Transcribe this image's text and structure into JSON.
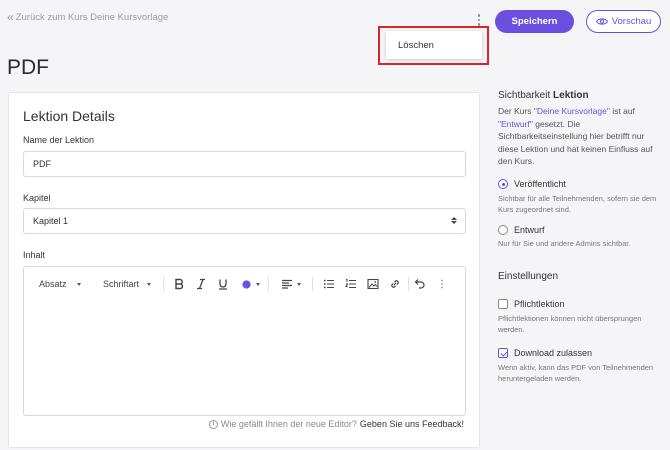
{
  "header": {
    "back_label": "Zurück zum Kurs Deine Kursvorlage",
    "save_label": "Speichern",
    "preview_label": "Vorschau"
  },
  "dropdown": {
    "delete_label": "Löschen"
  },
  "page": {
    "title": "PDF"
  },
  "lesson_details": {
    "title": "Lektion Details",
    "name_label": "Name der Lektion",
    "name_value": "PDF",
    "chapter_label": "Kapitel",
    "chapter_value": "Kapitel 1",
    "content_label": "Inhalt"
  },
  "editor": {
    "paragraph_label": "Absatz",
    "font_label": "Schriftart",
    "text_color": "#6b50e0",
    "feedback_question": "Wie gefällt Ihnen der neue Editor?",
    "feedback_link": "Geben Sie uns Feedback!"
  },
  "visibility": {
    "title_prefix": "Sichtbarkeit",
    "title_bold": "Lektion",
    "desc_1": "Der Kurs ",
    "course_name": "\"Deine Kursvorlage\"",
    "desc_2": " ist auf ",
    "status_name": "\"Entwurf\"",
    "desc_3": " gesetzt. Die Sichtbarkeitseinstellung hier betrifft nur diese Lektion und hat keinen Einfluss auf den Kurs.",
    "published_label": "Veröffentlicht",
    "published_desc": "Sichtbar für alle Teilnehmenden, sofern sie dem Kurs zugeordnet sind.",
    "draft_label": "Entwurf",
    "draft_desc": "Nur für Sie und andere Admins sichtbar.",
    "selected": "published"
  },
  "settings": {
    "title": "Einstellungen",
    "required_label": "Pflichtlektion",
    "required_desc": "Pflichtlektionen können nicht übersprungen werden.",
    "required_checked": false,
    "download_label": "Download zulassen",
    "download_desc": "Wenn aktiv, kann das PDF von Teilnehmenden heruntergeladen werden.",
    "download_checked": true
  },
  "colors": {
    "accent": "#6b50e0",
    "highlight_border": "#d9242b"
  }
}
